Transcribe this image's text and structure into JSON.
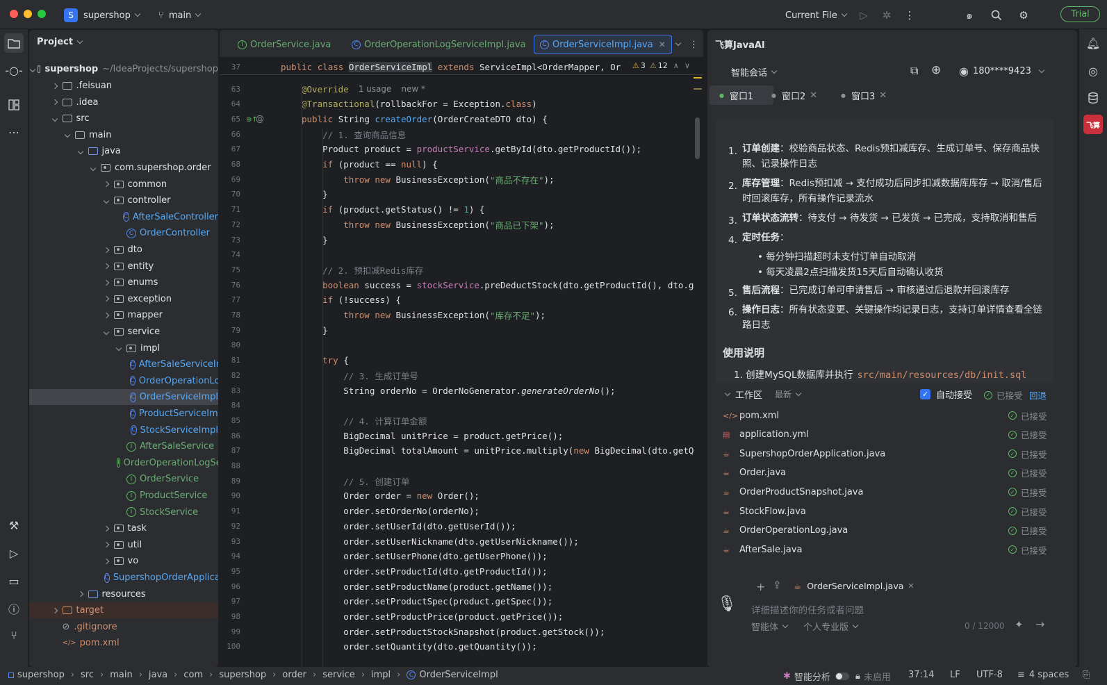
{
  "titlebar": {
    "project_badge": "S",
    "project_name": "supershop",
    "branch": "main",
    "run_config": "Current File",
    "trial": "Trial",
    "icons": [
      "branch-icon",
      "run-icon",
      "debug-icon",
      "more-icon",
      "ai-spiral-icon",
      "search-icon",
      "gear-icon"
    ]
  },
  "project_panel": {
    "title": "Project",
    "root_name": "supershop",
    "root_path": "~/IdeaProjects/supershop",
    "tree": [
      {
        "label": ".feisuan",
        "type": "folder",
        "depth": 1,
        "expanded": false
      },
      {
        "label": ".idea",
        "type": "folder",
        "depth": 1,
        "expanded": false
      },
      {
        "label": "src",
        "type": "folder",
        "depth": 1,
        "expanded": true
      },
      {
        "label": "main",
        "type": "folder",
        "depth": 2,
        "expanded": true
      },
      {
        "label": "java",
        "type": "folder-blue",
        "depth": 3,
        "expanded": true
      },
      {
        "label": "com.supershop.order",
        "type": "package",
        "depth": 4,
        "expanded": true
      },
      {
        "label": "common",
        "type": "package",
        "depth": 5,
        "expanded": false
      },
      {
        "label": "controller",
        "type": "package",
        "depth": 5,
        "expanded": true
      },
      {
        "label": "AfterSaleController",
        "type": "class",
        "depth": 6
      },
      {
        "label": "OrderController",
        "type": "class",
        "depth": 6
      },
      {
        "label": "dto",
        "type": "package",
        "depth": 5,
        "expanded": false
      },
      {
        "label": "entity",
        "type": "package",
        "depth": 5,
        "expanded": false
      },
      {
        "label": "enums",
        "type": "package",
        "depth": 5,
        "expanded": false
      },
      {
        "label": "exception",
        "type": "package",
        "depth": 5,
        "expanded": false
      },
      {
        "label": "mapper",
        "type": "package",
        "depth": 5,
        "expanded": false
      },
      {
        "label": "service",
        "type": "package",
        "depth": 5,
        "expanded": true
      },
      {
        "label": "impl",
        "type": "package",
        "depth": 6,
        "expanded": true
      },
      {
        "label": "AfterSaleServiceImpl",
        "type": "class",
        "depth": 7
      },
      {
        "label": "OrderOperationLogServiceImpl",
        "type": "class",
        "depth": 7
      },
      {
        "label": "OrderServiceImpl",
        "type": "class",
        "depth": 7,
        "selected": true
      },
      {
        "label": "ProductServiceImpl",
        "type": "class",
        "depth": 7
      },
      {
        "label": "StockServiceImpl",
        "type": "class",
        "depth": 7
      },
      {
        "label": "AfterSaleService",
        "type": "interface",
        "depth": 6
      },
      {
        "label": "OrderOperationLogService",
        "type": "interface",
        "depth": 6
      },
      {
        "label": "OrderService",
        "type": "interface",
        "depth": 6
      },
      {
        "label": "ProductService",
        "type": "interface",
        "depth": 6
      },
      {
        "label": "StockService",
        "type": "interface",
        "depth": 6
      },
      {
        "label": "task",
        "type": "package",
        "depth": 5,
        "expanded": false
      },
      {
        "label": "util",
        "type": "package",
        "depth": 5,
        "expanded": false
      },
      {
        "label": "vo",
        "type": "package",
        "depth": 5,
        "expanded": false
      },
      {
        "label": "SupershopOrderApplication",
        "type": "app",
        "depth": 5
      },
      {
        "label": "resources",
        "type": "folder-blue",
        "depth": 3,
        "expanded": false
      },
      {
        "label": "target",
        "type": "folder-orange",
        "depth": 1,
        "expanded": false,
        "target": true
      },
      {
        "label": ".gitignore",
        "type": "ignore",
        "depth": 1
      },
      {
        "label": "pom.xml",
        "type": "xml",
        "depth": 1
      }
    ]
  },
  "editor": {
    "tabs": [
      {
        "label": "OrderService.java",
        "kind": "interface",
        "active": false
      },
      {
        "label": "OrderOperationLogServiceImpl.java",
        "kind": "class",
        "active": false
      },
      {
        "label": "OrderServiceImpl.java",
        "kind": "class",
        "active": true
      }
    ],
    "sticky_line": "37",
    "sticky_parts": [
      "public ",
      "class ",
      "OrderServiceImpl",
      " extends ",
      "ServiceImpl<OrderMapper, Or"
    ],
    "warnings": "3",
    "weak_warnings": "12",
    "usage_hint": "1 usage",
    "new_hint": "new *",
    "lines": [
      {
        "n": "63",
        "p": [
          [
            "an",
            "@Override"
          ]
        ],
        "hint": true
      },
      {
        "n": "64",
        "p": [
          [
            "an",
            "@Transactional"
          ],
          [
            "",
            "(rollbackFor = Exception."
          ],
          [
            "kw",
            "class"
          ],
          [
            "",
            ")"
          ]
        ]
      },
      {
        "n": "65",
        "p": [
          [
            "kw",
            "public "
          ],
          [
            "",
            "String "
          ],
          [
            "fn",
            "createOrder"
          ],
          [
            "",
            "(OrderCreateDTO dto) {"
          ]
        ]
      },
      {
        "n": "66",
        "p": [
          [
            "cm",
            "    // 1. 查询商品信息"
          ]
        ]
      },
      {
        "n": "67",
        "p": [
          [
            "",
            "    Product product = "
          ],
          [
            "fld",
            "productService"
          ],
          [
            "",
            ".getById(dto.getProductId());"
          ]
        ]
      },
      {
        "n": "68",
        "p": [
          [
            "kw",
            "    if "
          ],
          [
            "",
            "(product == "
          ],
          [
            "kw",
            "null"
          ],
          [
            "",
            ") {"
          ]
        ]
      },
      {
        "n": "69",
        "p": [
          [
            "kw",
            "        throw new "
          ],
          [
            "",
            "BusinessException("
          ],
          [
            "str",
            "\"商品不存在\""
          ],
          [
            "",
            ");"
          ]
        ]
      },
      {
        "n": "70",
        "p": [
          [
            "",
            "    }"
          ]
        ]
      },
      {
        "n": "71",
        "p": [
          [
            "kw",
            "    if "
          ],
          [
            "",
            "(product.getStatus() != "
          ],
          [
            "num",
            "1"
          ],
          [
            "",
            ") {"
          ]
        ]
      },
      {
        "n": "72",
        "p": [
          [
            "kw",
            "        throw new "
          ],
          [
            "",
            "BusinessException("
          ],
          [
            "str",
            "\"商品已下架\""
          ],
          [
            "",
            ");"
          ]
        ]
      },
      {
        "n": "73",
        "p": [
          [
            "",
            "    }"
          ]
        ]
      },
      {
        "n": "74",
        "p": []
      },
      {
        "n": "75",
        "p": [
          [
            "cm",
            "    // 2. 预扣减Redis库存"
          ]
        ]
      },
      {
        "n": "76",
        "p": [
          [
            "kw",
            "    boolean "
          ],
          [
            "",
            "success = "
          ],
          [
            "fld",
            "stockService"
          ],
          [
            "",
            ".preDeductStock(dto.getProductId(), dto.g"
          ]
        ]
      },
      {
        "n": "77",
        "p": [
          [
            "kw",
            "    if "
          ],
          [
            "",
            "(!success) {"
          ]
        ]
      },
      {
        "n": "78",
        "p": [
          [
            "kw",
            "        throw new "
          ],
          [
            "",
            "BusinessException("
          ],
          [
            "str",
            "\"库存不足\""
          ],
          [
            "",
            ");"
          ]
        ]
      },
      {
        "n": "79",
        "p": [
          [
            "",
            "    }"
          ]
        ]
      },
      {
        "n": "80",
        "p": []
      },
      {
        "n": "81",
        "p": [
          [
            "kw",
            "    try "
          ],
          [
            "",
            "{"
          ]
        ]
      },
      {
        "n": "82",
        "p": [
          [
            "cm",
            "        // 3. 生成订单号"
          ]
        ]
      },
      {
        "n": "83",
        "p": [
          [
            "",
            "        String orderNo = OrderNoGenerator."
          ],
          [
            "it",
            "generateOrderNo"
          ],
          [
            "",
            "();"
          ]
        ]
      },
      {
        "n": "84",
        "p": []
      },
      {
        "n": "85",
        "p": [
          [
            "cm",
            "        // 4. 计算订单金额"
          ]
        ]
      },
      {
        "n": "86",
        "p": [
          [
            "",
            "        BigDecimal unitPrice = product.getPrice();"
          ]
        ]
      },
      {
        "n": "87",
        "p": [
          [
            "",
            "        BigDecimal totalAmount = unitPrice.multiply("
          ],
          [
            "kw",
            "new "
          ],
          [
            "",
            "BigDecimal(dto.getQ"
          ]
        ]
      },
      {
        "n": "88",
        "p": []
      },
      {
        "n": "89",
        "p": [
          [
            "cm",
            "        // 5. 创建订单"
          ]
        ]
      },
      {
        "n": "90",
        "p": [
          [
            "",
            "        Order order = "
          ],
          [
            "kw",
            "new "
          ],
          [
            "",
            "Order();"
          ]
        ]
      },
      {
        "n": "91",
        "p": [
          [
            "",
            "        order.setOrderNo(orderNo);"
          ]
        ]
      },
      {
        "n": "92",
        "p": [
          [
            "",
            "        order.setUserId(dto.getUserId());"
          ]
        ]
      },
      {
        "n": "93",
        "p": [
          [
            "",
            "        order.setUserNickname(dto.getUserNickname());"
          ]
        ]
      },
      {
        "n": "94",
        "p": [
          [
            "",
            "        order.setUserPhone(dto.getUserPhone());"
          ]
        ]
      },
      {
        "n": "95",
        "p": [
          [
            "",
            "        order.setProductId(dto.getProductId());"
          ]
        ]
      },
      {
        "n": "96",
        "p": [
          [
            "",
            "        order.setProductName(product.getName());"
          ]
        ]
      },
      {
        "n": "97",
        "p": [
          [
            "",
            "        order.setProductSpec(product.getSpec());"
          ]
        ]
      },
      {
        "n": "98",
        "p": [
          [
            "",
            "        order.setProductPrice(product.getPrice());"
          ]
        ]
      },
      {
        "n": "99",
        "p": [
          [
            "",
            "        order.setProductStockSnapshot(product.getStock());"
          ]
        ]
      },
      {
        "n": "100",
        "p": [
          [
            "",
            "        order.setQuantity(dto.getQuantity());"
          ]
        ]
      }
    ]
  },
  "ai_panel": {
    "title": "飞算JavaAI",
    "mode": "智能会话",
    "account": "180****9423",
    "windows": [
      {
        "label": "窗口1",
        "active": true
      },
      {
        "label": "窗口2",
        "active": false
      },
      {
        "label": "窗口3",
        "active": false
      }
    ],
    "items": [
      {
        "num": "1.",
        "bold": "订单创建",
        "text": "：校验商品状态、Redis预扣减库存、生成订单号、保存商品快照、记录操作日志"
      },
      {
        "num": "2.",
        "bold": "库存管理",
        "text": "：Redis预扣减 → 支付成功后同步扣减数据库库存 → 取消/售后时回滚库存，所有操作记录流水"
      },
      {
        "num": "3.",
        "bold": "订单状态流转",
        "text": "：待支付 → 待发货 → 已发货 → 已完成，支持取消和售后"
      },
      {
        "num": "4.",
        "bold": "定时任务",
        "text": "："
      },
      {
        "num": "5.",
        "bold": "售后流程",
        "text": "：已完成订单可申请售后 → 审核通过后退款并回滚库存"
      },
      {
        "num": "6.",
        "bold": "操作日志",
        "text": "：所有状态变更、关键操作均记录日志，支持订单详情查看全链路日志"
      }
    ],
    "sub_items": [
      "每分钟扫描超时未支付订单自动取消",
      "每天凌晨2点扫描发货15天后自动确认收货"
    ],
    "usage_title": "使用说明",
    "usage_cut": "1. 创建MySQL数据库并执行",
    "usage_cut_path": "src/main/resources/db/init.sql",
    "workspace": {
      "label": "工作区",
      "sort": "最新",
      "auto_accept": "自动接受",
      "accepted": "已接受",
      "rollback": "回退",
      "files": [
        {
          "name": "pom.xml",
          "icon": "xml",
          "status": "已接受"
        },
        {
          "name": "application.yml",
          "icon": "yml",
          "status": "已接受"
        },
        {
          "name": "SupershopOrderApplication.java",
          "icon": "java",
          "status": "已接受"
        },
        {
          "name": "Order.java",
          "icon": "java",
          "status": "已接受"
        },
        {
          "name": "OrderProductSnapshot.java",
          "icon": "java",
          "status": "已接受"
        },
        {
          "name": "StockFlow.java",
          "icon": "java",
          "status": "已接受"
        },
        {
          "name": "OrderOperationLog.java",
          "icon": "java",
          "status": "已接受"
        },
        {
          "name": "AfterSale.java",
          "icon": "java",
          "status": "已接受"
        }
      ]
    },
    "input": {
      "context_file": "OrderServiceImpl.java",
      "placeholder": "详细描述你的任务或者问题",
      "model": "智能体",
      "plan": "个人专业版",
      "count": "0 / 12000"
    }
  },
  "statusbar": {
    "breadcrumb": [
      "supershop",
      "src",
      "main",
      "java",
      "com",
      "supershop",
      "order",
      "service",
      "impl",
      "OrderServiceImpl"
    ],
    "smart": "智能分析",
    "disabled": "未启用",
    "position": "37:14",
    "line_sep": "LF",
    "encoding": "UTF-8",
    "indent": "4 spaces"
  },
  "colors": {
    "accent": "#3574f0",
    "green": "#5fb865",
    "keyword": "#cf8e6d",
    "string": "#6aab73",
    "annotation": "#b3ae60",
    "method": "#56a8f5",
    "field": "#c77dbb"
  }
}
